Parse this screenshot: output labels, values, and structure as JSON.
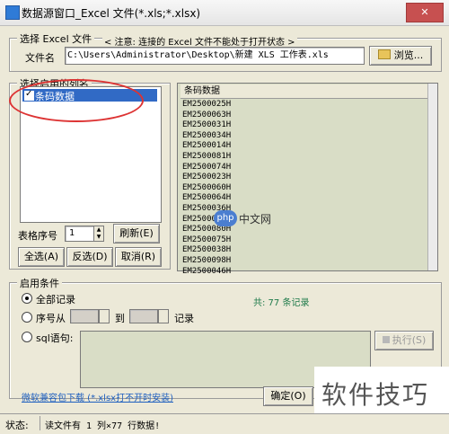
{
  "window": {
    "title": "数据源窗口_Excel 文件(*.xls;*.xlsx)",
    "close_label": "✕"
  },
  "file_group": {
    "label": "选择 Excel 文件",
    "note": "< 注意: 连接的 Excel 文件不能处于打开状态 >",
    "file_label": "文件名",
    "file_value": "C:\\Users\\Administrator\\Desktop\\新建 XLS 工作表.xls",
    "browse_label": "浏览..."
  },
  "columns_group": {
    "label": "选择启用的列名",
    "items": [
      {
        "label": "条码数据",
        "checked": true
      }
    ],
    "table_index_label": "表格序号",
    "table_index_value": "1",
    "refresh_label": "刷新(E)",
    "select_all_label": "全选(A)",
    "invert_label": "反选(D)",
    "cancel_label": "取消(R)"
  },
  "data_view": {
    "column_header": "条码数据",
    "rows": [
      "EM2500025H",
      "EM2500063H",
      "EM2500031H",
      "EM2500034H",
      "EM2500014H",
      "EM2500081H",
      "EM2500074H",
      "EM2500023H",
      "EM2500060H",
      "EM2500064H",
      "EM2500036H",
      "EM2500049H",
      "EM2500080H",
      "EM2500075H",
      "EM2500038H",
      "EM2500098H",
      "EM2500046H"
    ]
  },
  "conditions": {
    "label": "启用条件",
    "all_records_label": "全部记录",
    "record_count": "共: 77 条记录",
    "range_prefix": "序号从",
    "range_to": "到",
    "range_suffix": "记录",
    "sql_label": "sql语句:",
    "execute_label": "执行(S)"
  },
  "footer": {
    "download_link": "微软兼容包下载 (*.xlsx打不开时安装)",
    "ok_label": "确定(O)"
  },
  "statusbar": {
    "label": "状态:",
    "text": "读文件有 1 列×77 行数据!"
  },
  "watermarks": {
    "php_badge": "php",
    "php_text": "中文网",
    "corner_text": "软件技巧"
  },
  "colors": {
    "accent_red": "#d33333",
    "selection_blue": "#316ac5",
    "data_bg": "#d9ddc6"
  }
}
